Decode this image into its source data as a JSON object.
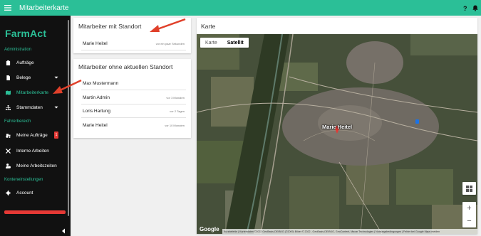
{
  "topbar": {
    "title": "Mitarbeiterkarte",
    "help_icon": "help-icon",
    "bell_icon": "bell-icon",
    "color": "#2bbf97"
  },
  "sidebar": {
    "logo": "FarmAct",
    "sections": {
      "admin": "Administration",
      "fahrer": "Fahrerbereich",
      "konto": "Konteneinstellungen"
    },
    "items": [
      {
        "label": "Aufträge",
        "icon": "clipboard-icon"
      },
      {
        "label": "Belege",
        "icon": "document-icon"
      },
      {
        "label": "Mitarbeiterkarte",
        "icon": "map-icon",
        "active": true
      },
      {
        "label": "Stammdaten",
        "icon": "hierarchy-icon"
      },
      {
        "label": "Meine Aufträge",
        "icon": "tractor-icon",
        "badge": "1"
      },
      {
        "label": "Interne Arbeiten",
        "icon": "tools-icon"
      },
      {
        "label": "Meine Arbeitszeiten",
        "icon": "user-clock-icon"
      },
      {
        "label": "Account",
        "icon": "settings-icon"
      }
    ]
  },
  "with_location": {
    "title": "Mitarbeiter mit Standort",
    "rows": [
      {
        "name": "Marie Heitel",
        "time": "vor ein paar Sekunden"
      }
    ]
  },
  "without_location": {
    "title": "Mitarbeiter ohne aktuellen Standort",
    "rows": [
      {
        "name": "Max Mustermann",
        "time": ""
      },
      {
        "name": "Martin Admin",
        "time": "vor 3 Monaten"
      },
      {
        "name": "Loris Hartung",
        "time": "vor 2 Tagen"
      },
      {
        "name": "Marie Heitel",
        "time": "vor 10 Monaten"
      }
    ]
  },
  "map_card": {
    "title": "Karte",
    "toggle": {
      "map": "Karte",
      "satellite": "Satellit",
      "selected": "satellite"
    },
    "marker_label": "Marie Heitel",
    "google": "Google",
    "attribution": "Kurzbefehle | Kartendaten ©2022 GeoBasis-DE/BKG (©2009) Bilder © 2022 , GeoBasis-DE/BKG, GeoContent, Maxar Technologies | Nutzungsbedingungen | Fehler bei Google Maps melden",
    "zoom_in": "+",
    "zoom_out": "−"
  },
  "colors": {
    "accent": "#2bbf97",
    "arrow": "#e0402a",
    "badge": "#e53935"
  }
}
